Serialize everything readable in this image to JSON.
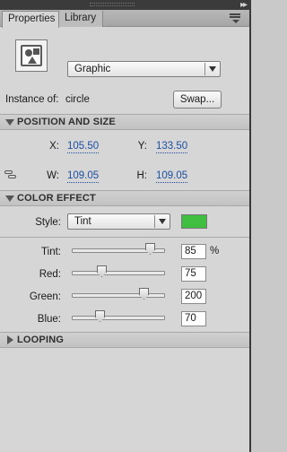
{
  "tabs": [
    {
      "label": "Properties",
      "active": true
    },
    {
      "label": "Library",
      "active": false
    }
  ],
  "symbol": {
    "type_icon": "symbol-icon",
    "type_value": "Graphic"
  },
  "instance": {
    "label": "Instance of:",
    "name": "circle",
    "swap_label": "Swap..."
  },
  "position_size": {
    "title": "POSITION AND SIZE",
    "x_label": "X:",
    "x_value": "105.50",
    "y_label": "Y:",
    "y_value": "133.50",
    "w_label": "W:",
    "w_value": "109.05",
    "h_label": "H:",
    "h_value": "109.05"
  },
  "color_effect": {
    "title": "COLOR EFFECT",
    "style_label": "Style:",
    "style_value": "Tint",
    "swatch_color": "#3fbe3f",
    "rows": [
      {
        "label": "Tint:",
        "value": "85",
        "unit": "%",
        "fraction": 0.85
      },
      {
        "label": "Red:",
        "value": "75",
        "unit": "",
        "fraction": 0.294
      },
      {
        "label": "Green:",
        "value": "200",
        "unit": "",
        "fraction": 0.784
      },
      {
        "label": "Blue:",
        "value": "70",
        "unit": "",
        "fraction": 0.275
      }
    ]
  },
  "looping": {
    "title": "LOOPING"
  }
}
